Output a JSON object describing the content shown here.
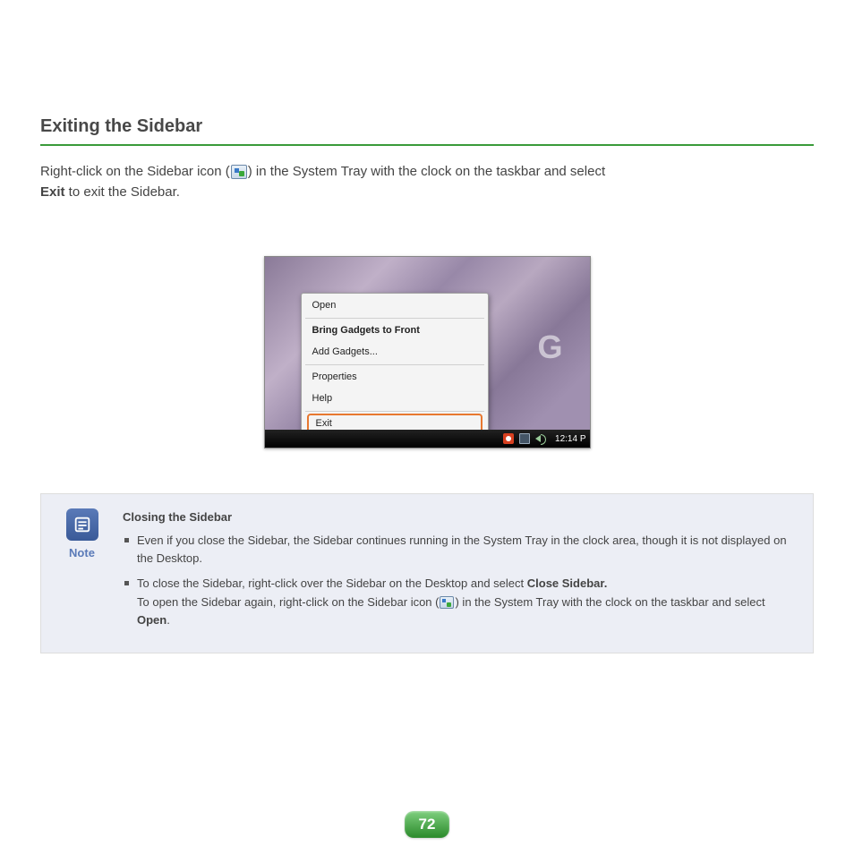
{
  "section_title": "Exiting the Sidebar",
  "intro": {
    "pre": "Right-click on the Sidebar icon (",
    "post": ") in the System Tray with the clock on the taskbar and select ",
    "bold": "Exit",
    "tail": " to exit the Sidebar."
  },
  "screenshot": {
    "decor_letter": "G",
    "menu": {
      "open": "Open",
      "bring_front": "Bring Gadgets to Front",
      "add_gadgets": "Add Gadgets...",
      "properties": "Properties",
      "help": "Help",
      "exit": "Exit"
    },
    "clock": "12:14 P"
  },
  "note": {
    "label": "Note",
    "subtitle": "Closing the Sidebar",
    "bullet1": "Even if you close the Sidebar, the Sidebar continues running in the System Tray in the clock area, though it is not displayed on the Desktop.",
    "bullet2": {
      "a": "To close the Sidebar, right-click over the Sidebar on the Desktop and select ",
      "b_bold": "Close Sidebar.",
      "c": "To open the Sidebar again, right-click on the Sidebar icon (",
      "d": ") in the System Tray with the clock on the taskbar and select ",
      "e_bold": "Open",
      "f": "."
    }
  },
  "page_number": "72"
}
